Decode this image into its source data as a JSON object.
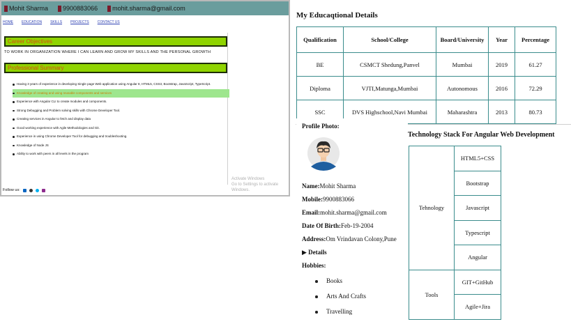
{
  "left_page": {
    "topbar": [
      {
        "label": "Mohit Sharma"
      },
      {
        "label": "9900883066"
      },
      {
        "label": "mohit.sharma@gmail.com"
      }
    ],
    "nav": [
      "HOME",
      "EDUCATION",
      "SKILLS",
      "PROJECTS",
      "CONTACT US"
    ],
    "career_title": "Career Objectives",
    "career_text": "TO WORK IN ORGANIZATION WHERE I CAN LEARN AND GROW MY SKILLS AND THE PERSONAL GROWTH",
    "summary_title": "Professional Summary",
    "summary_items": [
      "Having 3 years of experience in developing Single page Web application using Angular 8, HTML5, CSS3, Bootstrap, JavaScript, TypeScript.",
      "Knowledge of creating and using reusable components and services",
      "Experience with Angular CLI to create modules and components.",
      "Strong Debugging and Problem solving skills with Chrome Developer Tool.",
      "Creating services in Angular to fetch and display data",
      "Good working experience with Agile Methodologies and Git.",
      "Experience in using Chrome Developer Tool for debugging and troubleshooting.",
      "Knowledge of Node JS",
      "Ability to work with peers in all levels in the program"
    ],
    "watermark_line1": "Activate Windows",
    "watermark_line2": "Go to Settings to activate Windows.",
    "footer_label": "Follow us:",
    "footer_icons": [
      "linkedin-icon",
      "github-icon",
      "skype-icon",
      "facebook-icon"
    ]
  },
  "education": {
    "title": "My Educaqtional Details",
    "headers": [
      "Qualification",
      "School/College",
      "Board/University",
      "Year",
      "Percentage"
    ],
    "rows": [
      [
        "BE",
        "CSMCT Shedung,Panvel",
        "Mumbai",
        "2019",
        "61.27"
      ],
      [
        "Diploma",
        "VJTI,Matunga,Mumbai",
        "Autonomous",
        "2016",
        "72.29"
      ],
      [
        "SSC",
        "DVS Highschool,Navi Mumbai",
        "Maharashtra",
        "2013",
        "80.73"
      ]
    ]
  },
  "profile": {
    "photo_label": "Profile Photo:",
    "fields": [
      {
        "label": "Name:",
        "value": "Mohit Sharma"
      },
      {
        "label": "Mobile:",
        "value": "9900883066"
      },
      {
        "label": "Email:",
        "value": "mohit.sharma@gmail.com"
      },
      {
        "label": "Date Of Birth:",
        "value": "Feb-19-2004"
      },
      {
        "label": "Address:",
        "value": "Om Vrindavan Colony,Pune"
      }
    ],
    "details_label": "Details",
    "hobbies_label": "Hobbies:",
    "hobbies": [
      "Books",
      "Arts And Crafts",
      "Travelling"
    ]
  },
  "tech": {
    "title": "Technology Stack For Angular Web Development",
    "groups": [
      {
        "category": "Tehnology",
        "items": [
          "HTML5+CSS",
          "Bootstrap",
          "Javascript",
          "Typescript",
          "Angular"
        ]
      },
      {
        "category": "Tools",
        "items": [
          "GIT+GitHub",
          "Agile+Jira"
        ]
      }
    ]
  },
  "colors": {
    "topbar": "#6a9d9d",
    "section_box": "#8fd400",
    "section_text": "#d84a10",
    "table_border": "#3a8c8c",
    "highlight_row": "#9ee68e"
  }
}
